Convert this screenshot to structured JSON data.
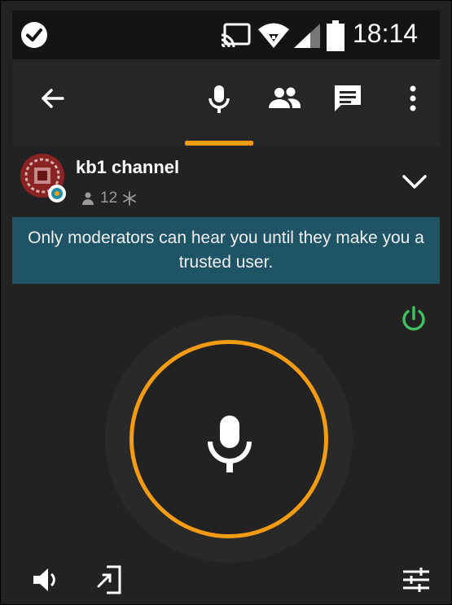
{
  "status_bar": {
    "time": "18:14",
    "icons": [
      "check-circle-icon",
      "cast-icon",
      "wifi-icon",
      "signal-icon",
      "battery-icon"
    ]
  },
  "toolbar": {
    "tabs": [
      {
        "name": "microphone-tab",
        "icon": "mic-icon",
        "active": true
      },
      {
        "name": "users-tab",
        "icon": "people-icon",
        "active": false
      },
      {
        "name": "chat-tab",
        "icon": "chat-icon",
        "active": false
      }
    ],
    "accent_color": "#f39c12"
  },
  "channel": {
    "name": "kb1 channel",
    "member_count": "12"
  },
  "banner": {
    "text": "Only moderators can hear you until they make you a trusted user.",
    "background": "#1e5466"
  },
  "controls": {
    "power_color": "#3fbf5f",
    "ptt_ring_color": "#f39c12"
  }
}
